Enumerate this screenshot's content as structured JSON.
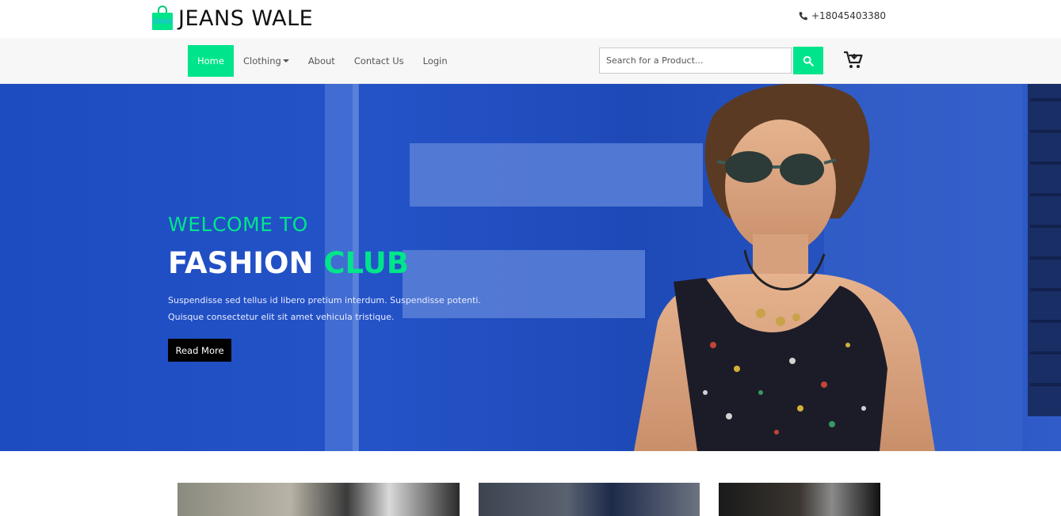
{
  "brand": {
    "name": "JEANS WALE",
    "icon": "shopping-bag-icon",
    "icon_color": "#00e58b"
  },
  "contact": {
    "phone": "+18045403380",
    "icon": "phone-icon"
  },
  "nav": {
    "items": [
      {
        "label": "Home",
        "active": true
      },
      {
        "label": "Clothing",
        "dropdown": true
      },
      {
        "label": "About"
      },
      {
        "label": "Contact Us"
      },
      {
        "label": "Login"
      }
    ],
    "search_placeholder": "Search for a Product...",
    "search_icon": "search-icon",
    "cart_icon": "cart-icon"
  },
  "hero": {
    "welcome": "WELCOME TO",
    "title_main": "FASHION",
    "title_accent": "CLUB",
    "description": "Suspendisse sed tellus id libero pretium interdum. Suspendisse potenti. Quisque consectetur elit sit amet vehicula tristique.",
    "button_label": "Read More"
  },
  "colors": {
    "accent": "#00e58b",
    "hero_blue": "#1f4fc6",
    "nav_bg": "#f7f7f7"
  }
}
